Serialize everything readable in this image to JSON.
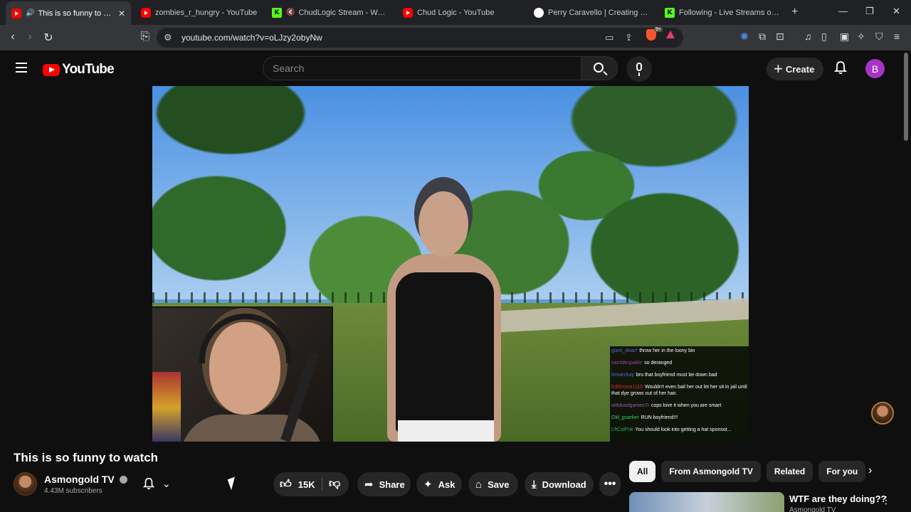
{
  "browser": {
    "tabs": [
      {
        "title": "This is so funny to watch",
        "favicon": "youtube",
        "active": true,
        "audio": true
      },
      {
        "title": "zombies_r_hungry - YouTube",
        "favicon": "youtube"
      },
      {
        "title": "ChudLogic Stream - Watch L",
        "favicon": "kick",
        "muted": true
      },
      {
        "title": "Chud Logic - YouTube",
        "favicon": "youtube"
      },
      {
        "title": "Perry Caravello | Creating Come",
        "favicon": "patreon"
      },
      {
        "title": "Following - Live Streams on Kick",
        "favicon": "kick"
      }
    ],
    "url": "youtube.com/watch?v=oLJzy2obyNw",
    "brave_badge": "9+"
  },
  "header": {
    "logo_text": "YouTube",
    "search_placeholder": "Search",
    "create_label": "Create",
    "avatar_letter": "B",
    "avatar_color": "#a733c7"
  },
  "chat": [
    {
      "user": "giant_dwarf",
      "color": "#4b6bd8",
      "message": "throw her in the loony bin"
    },
    {
      "user": "saintdespable",
      "color": "#8e44ad",
      "message": "so deranged"
    },
    {
      "user": "bimarckay",
      "color": "#4b6bd8",
      "message": "bro that boyfriend must be down bad"
    },
    {
      "user": "frdlthrone1115",
      "color": "#d03030",
      "message": "Wouldn't even bail her out let her sit in jail until that dye grows out of her hair."
    },
    {
      "user": "oldskoolgamez7r",
      "color": "#9b59b6",
      "message": "cops love it when you are smart"
    },
    {
      "user": "Old_graeker",
      "color": "#2ecc71",
      "message": "RUN boyfriend!!!"
    },
    {
      "user": "LftCstPnk",
      "color": "#27ae60",
      "message": "You should look into getting a hat sponsor..."
    }
  ],
  "video": {
    "title": "This is so funny to watch",
    "channel": "Asmongold TV",
    "subscribers": "4.43M subscribers",
    "likes": "15K"
  },
  "actions": {
    "share": "Share",
    "ask": "Ask",
    "save": "Save",
    "download": "Download"
  },
  "chips": [
    "All",
    "From Asmongold TV",
    "Related",
    "For you"
  ],
  "recommendation": {
    "title": "WTF are they doing??",
    "channel": "Asmongold TV"
  }
}
